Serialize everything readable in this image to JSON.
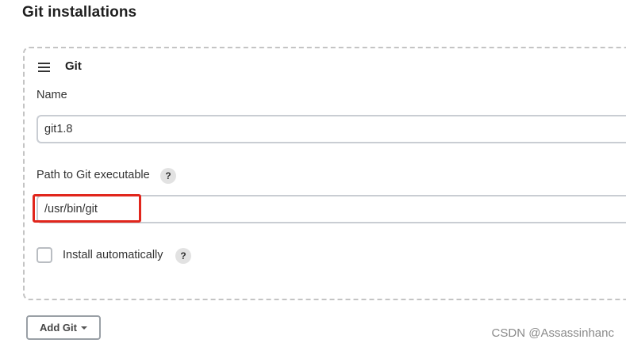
{
  "section": {
    "title": "Git installations"
  },
  "tool": {
    "name": "Git",
    "name_field": {
      "label": "Name",
      "value": "git1.8"
    },
    "path_field": {
      "label": "Path to Git executable",
      "value": "/usr/bin/git",
      "help": "?"
    },
    "install_auto": {
      "label": "Install automatically",
      "checked": false,
      "help": "?"
    }
  },
  "actions": {
    "add_label": "Add Git"
  },
  "watermark": "CSDN @Assassinhanc",
  "colors": {
    "highlight": "#e1261c",
    "border_dashed": "#c4c4c4"
  }
}
